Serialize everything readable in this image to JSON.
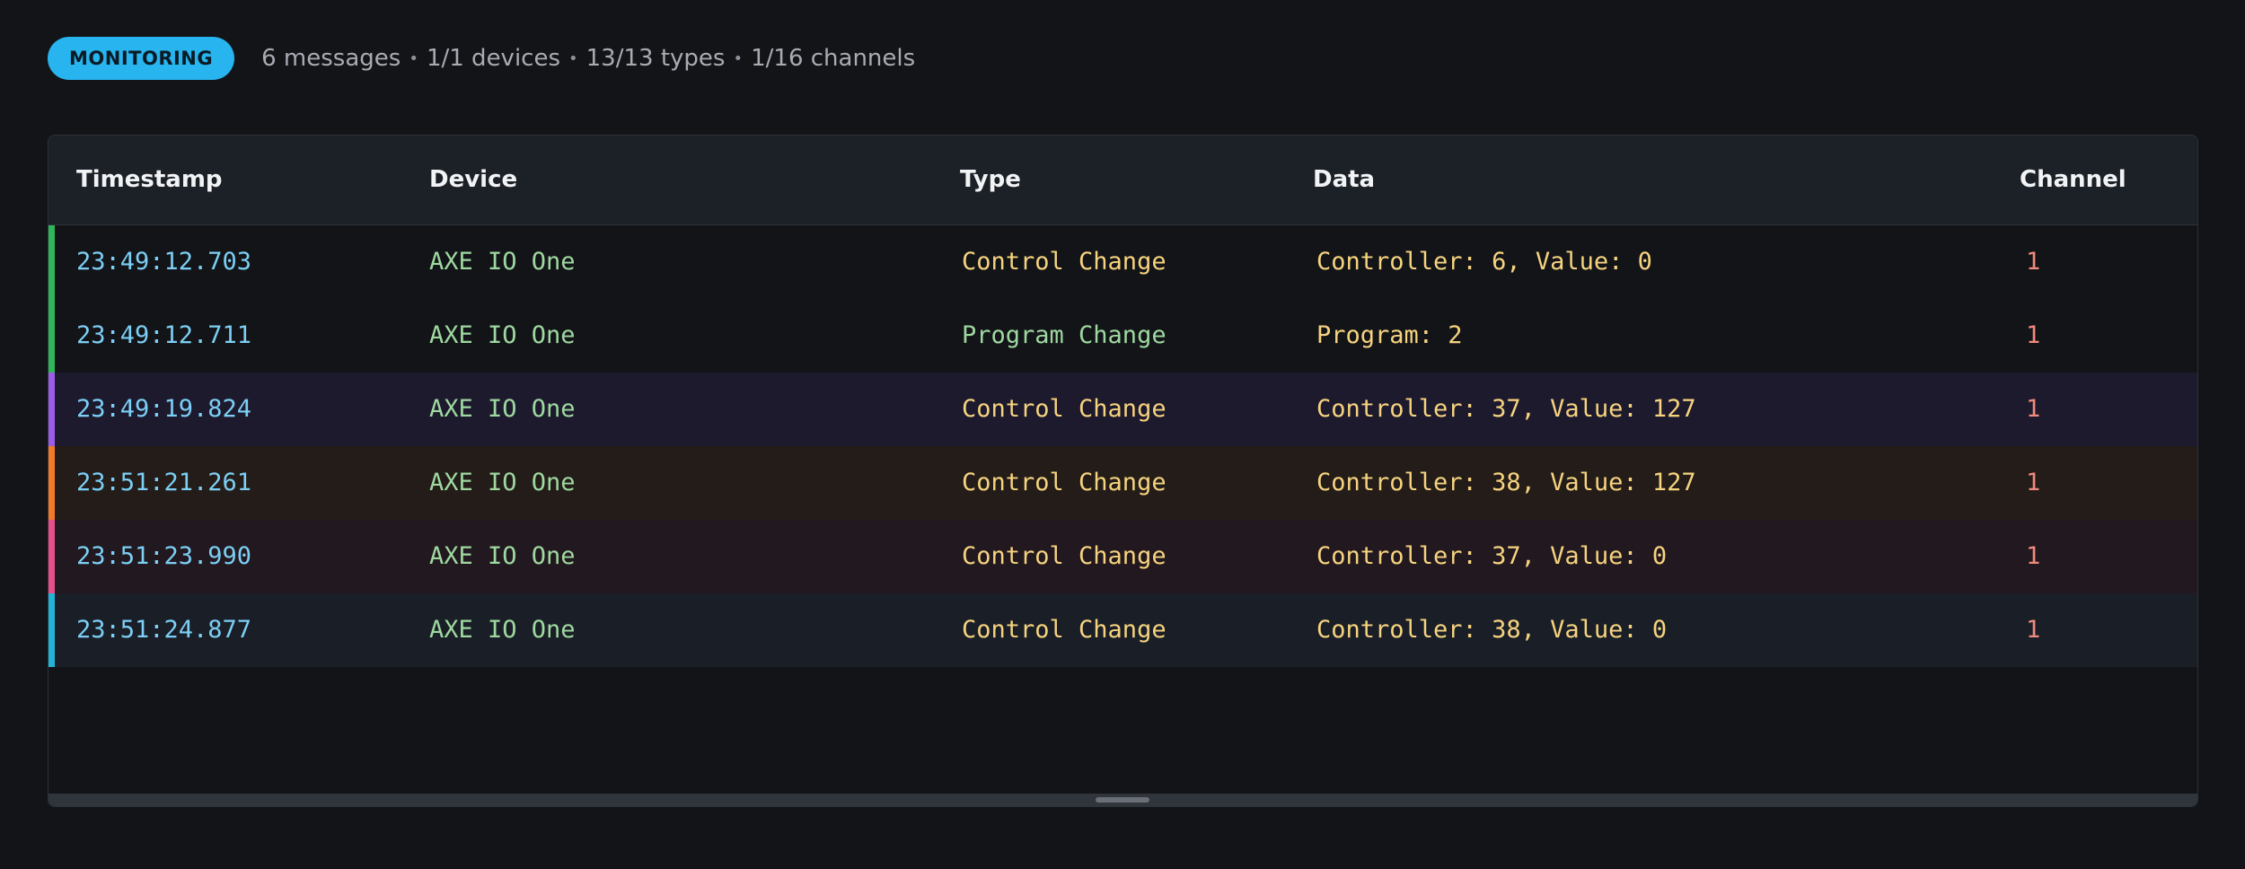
{
  "status": {
    "badge": "MONITORING",
    "messages": "6 messages",
    "devices": "1/1 devices",
    "types": "13/13 types",
    "channels": "1/16 channels",
    "separator": "•"
  },
  "table": {
    "columns": [
      "Timestamp",
      "Device",
      "Type",
      "Data",
      "Channel"
    ],
    "rows": [
      {
        "timestamp": "23:49:12.703",
        "device": "AXE IO One",
        "type": "Control Change",
        "data": "Controller: 6, Value: 0",
        "channel": "1",
        "accent": "#2fb65a",
        "bg": "#131418"
      },
      {
        "timestamp": "23:49:12.711",
        "device": "AXE IO One",
        "type": "Program Change",
        "data": "Program: 2",
        "channel": "1",
        "accent": "#2fb65a",
        "bg": "#131418"
      },
      {
        "timestamp": "23:49:19.824",
        "device": "AXE IO One",
        "type": "Control Change",
        "data": "Controller: 37, Value: 127",
        "channel": "1",
        "accent": "#9b5de5",
        "bg": "#1d1a2e"
      },
      {
        "timestamp": "23:51:21.261",
        "device": "AXE IO One",
        "type": "Control Change",
        "data": "Controller: 38, Value: 127",
        "channel": "1",
        "accent": "#f07a2a",
        "bg": "#231c18"
      },
      {
        "timestamp": "23:51:23.990",
        "device": "AXE IO One",
        "type": "Control Change",
        "data": "Controller: 37, Value: 0",
        "channel": "1",
        "accent": "#e84f8a",
        "bg": "#22181f"
      },
      {
        "timestamp": "23:51:24.877",
        "device": "AXE IO One",
        "type": "Control Change",
        "data": "Controller: 38, Value: 0",
        "channel": "1",
        "accent": "#22b3d6",
        "bg": "#1a1f27"
      }
    ]
  },
  "colors": {
    "badge": "#27b4ef",
    "background": "#131418",
    "header": "#1c2027"
  }
}
